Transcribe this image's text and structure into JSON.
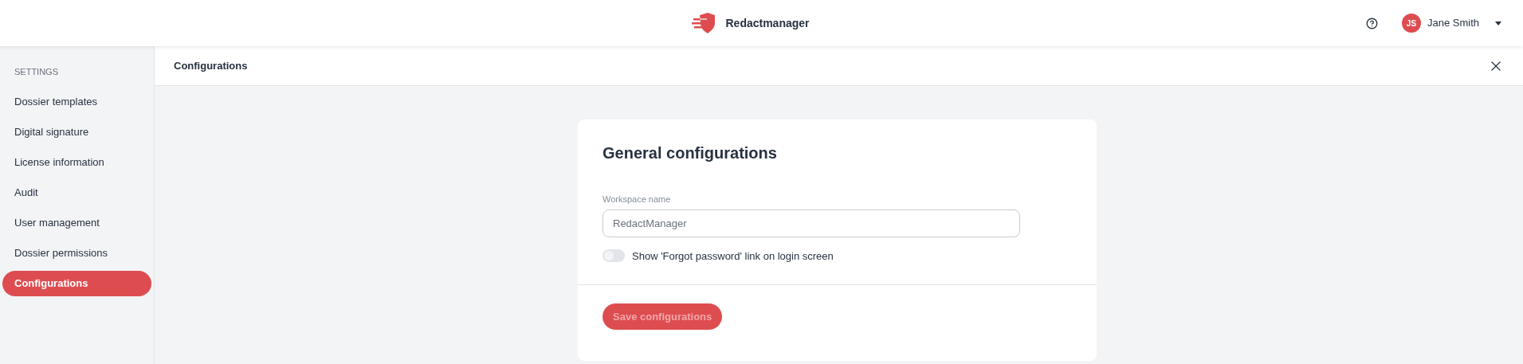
{
  "header": {
    "app_name": "Redactmanager",
    "user": {
      "initials": "JS",
      "name": "Jane Smith"
    }
  },
  "sidebar": {
    "heading": "SETTINGS",
    "items": [
      {
        "label": "Dossier templates",
        "selected": false
      },
      {
        "label": "Digital signature",
        "selected": false
      },
      {
        "label": "License information",
        "selected": false
      },
      {
        "label": "Audit",
        "selected": false
      },
      {
        "label": "User management",
        "selected": false
      },
      {
        "label": "Dossier permissions",
        "selected": false
      },
      {
        "label": "Configurations",
        "selected": true
      }
    ]
  },
  "page": {
    "title": "Configurations"
  },
  "card": {
    "title": "General configurations",
    "workspace_field": {
      "label": "Workspace name",
      "value": "RedactManager"
    },
    "forgot_password_toggle": {
      "label": "Show 'Forgot password' link on login screen",
      "on": false
    },
    "save_button": {
      "label": "Save configurations",
      "disabled": true
    }
  }
}
